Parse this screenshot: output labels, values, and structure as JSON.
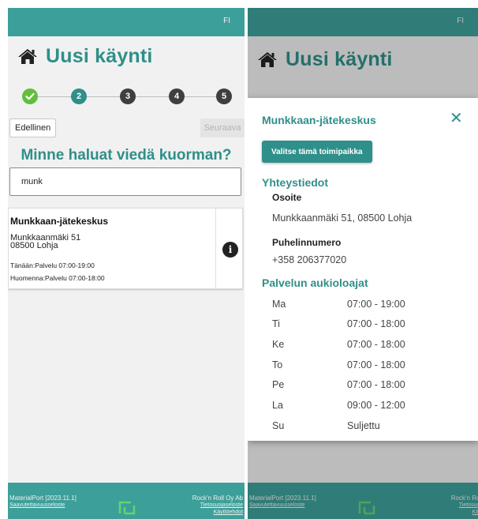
{
  "header": {
    "lang": "FI"
  },
  "page": {
    "title": "Uusi käynti",
    "question": "Minne haluat viedä kuorman?"
  },
  "stepper": {
    "steps": [
      {
        "label": "",
        "state": "done"
      },
      {
        "label": "2",
        "state": "active"
      },
      {
        "label": "3",
        "state": "todo"
      },
      {
        "label": "4",
        "state": "todo"
      },
      {
        "label": "5",
        "state": "todo"
      }
    ]
  },
  "nav": {
    "prev": "Edellinen",
    "next": "Seuraava"
  },
  "search": {
    "value": "munk"
  },
  "result": {
    "name": "Munkkaan-jätekeskus",
    "street": "Munkkaanmäki 51",
    "postal": "08500 Lohja",
    "today": "Tänään:Palvelu 07:00-19:00",
    "tomorrow": "Huomenna:Palvelu 07:00-18:00"
  },
  "modal": {
    "title": "Munkkaan-jätekeskus",
    "select_button": "Valitse tämä toimipaikka",
    "contact_heading": "Yhteystiedot",
    "address_label": "Osoite",
    "address_value": "Munkkaanmäki 51, 08500 Lohja",
    "phone_label": "Puhelinnumero",
    "phone_value": "+358 206377020",
    "hours_heading": "Palvelun aukioloajat",
    "hours": [
      {
        "day": "Ma",
        "time": "07:00 - 19:00"
      },
      {
        "day": "Ti",
        "time": "07:00 - 18:00"
      },
      {
        "day": "Ke",
        "time": "07:00 - 18:00"
      },
      {
        "day": "To",
        "time": "07:00 - 18:00"
      },
      {
        "day": "Pe",
        "time": "07:00 - 18:00"
      },
      {
        "day": "La",
        "time": "09:00 - 12:00"
      },
      {
        "day": "Su",
        "time": "Suljettu"
      }
    ]
  },
  "footer": {
    "version": "MaterialPort [2023.11.1]",
    "accessibility": "Saavutettavuusseloste",
    "company": "Rock'n Roll Oy Ab",
    "privacy": "Tietosuojaseloste",
    "terms": "Käyttöehdot"
  },
  "colors": {
    "teal": "#3d9f9a",
    "teal_dark": "#2f8f8a",
    "step_done": "#63be3f",
    "step_todo": "#3f3f3f"
  }
}
